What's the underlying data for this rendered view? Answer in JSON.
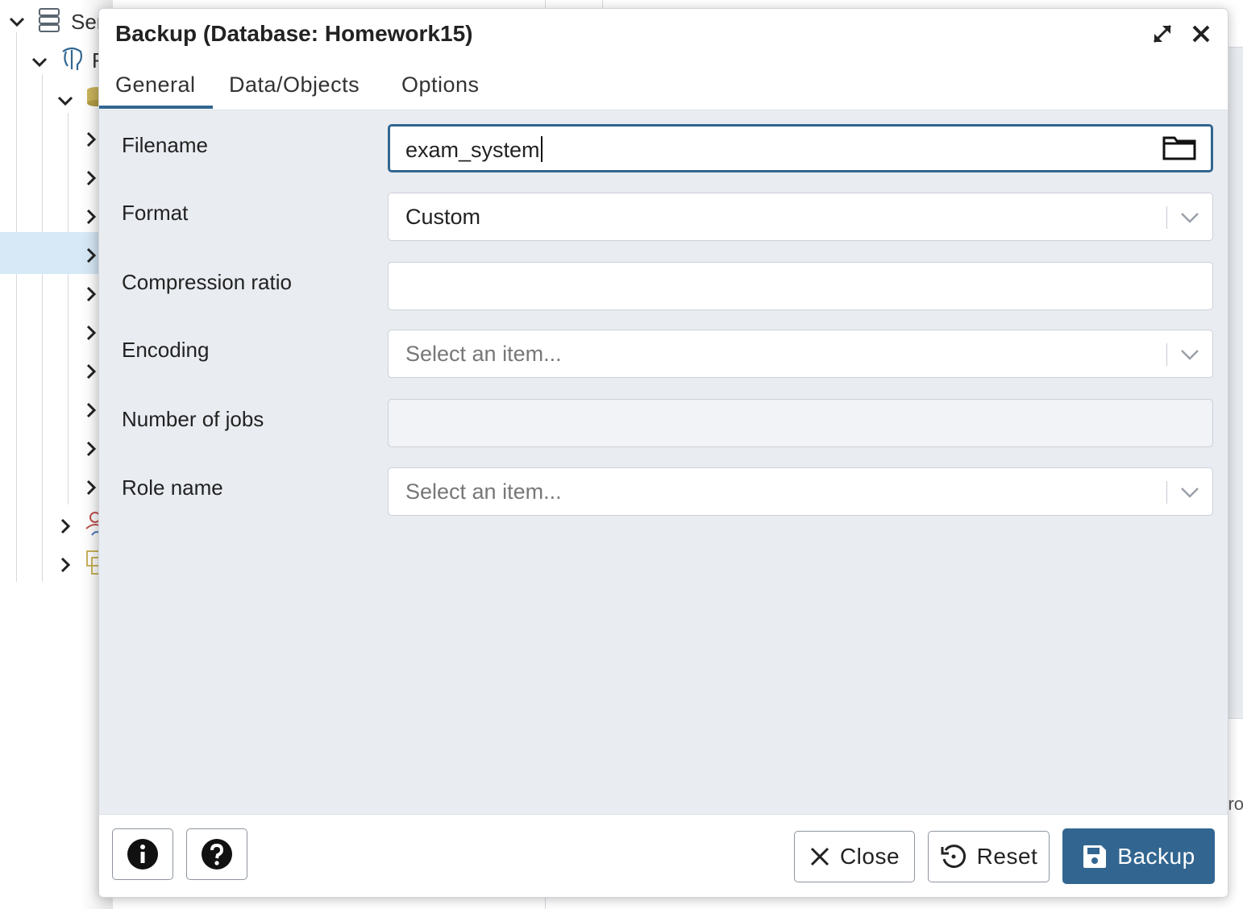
{
  "tree": {
    "server_label_fragment": "Ser",
    "second_label_fragment": "F"
  },
  "background": {
    "right_fragment": "ro"
  },
  "dialog": {
    "title": "Backup (Database: Homework15)",
    "tabs": [
      {
        "label": "General",
        "active": true
      },
      {
        "label": "Data/Objects",
        "active": false
      },
      {
        "label": "Options",
        "active": false
      }
    ],
    "fields": {
      "filename": {
        "label": "Filename",
        "value": "exam_system"
      },
      "format": {
        "label": "Format",
        "value": "Custom"
      },
      "compression": {
        "label": "Compression ratio",
        "value": ""
      },
      "encoding": {
        "label": "Encoding",
        "placeholder": "Select an item..."
      },
      "jobs": {
        "label": "Number of jobs",
        "value": ""
      },
      "role": {
        "label": "Role name",
        "placeholder": "Select an item..."
      }
    },
    "footer": {
      "close_label": "Close",
      "reset_label": "Reset",
      "backup_label": "Backup"
    }
  },
  "colors": {
    "accent": "#326690",
    "dialog_body": "#e9ecf1",
    "selected_row": "#d7e9f6"
  },
  "icons": [
    "server-icon",
    "elephant-icon",
    "database-icon",
    "chevron-right-icon",
    "chevron-down-icon",
    "maximize-icon",
    "close-icon",
    "folder-icon",
    "info-icon",
    "help-icon",
    "undo-icon",
    "save-icon",
    "login-roles-icon",
    "tablespaces-icon"
  ]
}
